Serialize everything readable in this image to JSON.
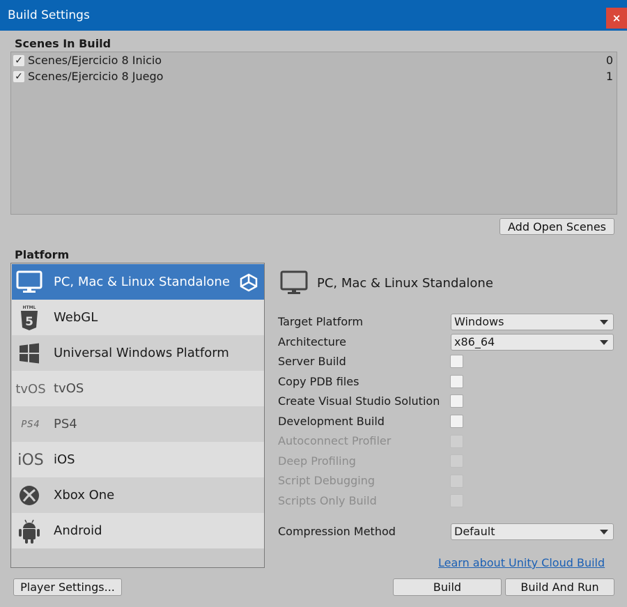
{
  "window": {
    "title": "Build Settings",
    "close_glyph": "×"
  },
  "scenes": {
    "title": "Scenes In Build",
    "items": [
      {
        "name": "Scenes/Ejercicio 8 Inicio",
        "index": "0",
        "checked": true
      },
      {
        "name": "Scenes/Ejercicio 8 Juego",
        "index": "1",
        "checked": true
      }
    ],
    "add_open_scenes_label": "Add Open Scenes"
  },
  "platform": {
    "title": "Platform",
    "items": [
      {
        "label": "PC, Mac & Linux Standalone",
        "icon": "monitor-icon",
        "selected": true,
        "active": true
      },
      {
        "label": "WebGL",
        "icon": "html5-icon"
      },
      {
        "label": "Universal Windows Platform",
        "icon": "windows-icon"
      },
      {
        "label": "tvOS",
        "icon": "tvos-icon",
        "icon_text": "tvOS"
      },
      {
        "label": "PS4",
        "icon": "ps4-icon",
        "icon_text": "PS4"
      },
      {
        "label": "iOS",
        "icon": "ios-icon",
        "icon_text": "iOS"
      },
      {
        "label": "Xbox One",
        "icon": "xbox-icon"
      },
      {
        "label": "Android",
        "icon": "android-icon"
      }
    ]
  },
  "settings": {
    "header_label": "PC, Mac & Linux Standalone",
    "target_platform": {
      "label": "Target Platform",
      "value": "Windows"
    },
    "architecture": {
      "label": "Architecture",
      "value": "x86_64"
    },
    "server_build": "Server Build",
    "copy_pdb": "Copy PDB files",
    "create_vs_solution": "Create Visual Studio Solution",
    "development_build": "Development Build",
    "autoconnect_profiler": "Autoconnect Profiler",
    "deep_profiling": "Deep Profiling",
    "script_debugging": "Script Debugging",
    "scripts_only_build": "Scripts Only Build",
    "compression": {
      "label": "Compression Method",
      "value": "Default"
    },
    "cloud_build_link": "Learn about Unity Cloud Build"
  },
  "footer": {
    "player_settings_label": "Player Settings...",
    "build_label": "Build",
    "build_and_run_label": "Build And Run"
  },
  "colors": {
    "titlebar": "#0a64b4",
    "selected_platform": "#3b79c0",
    "close_button": "#d9473a",
    "link": "#1a5fb4"
  }
}
